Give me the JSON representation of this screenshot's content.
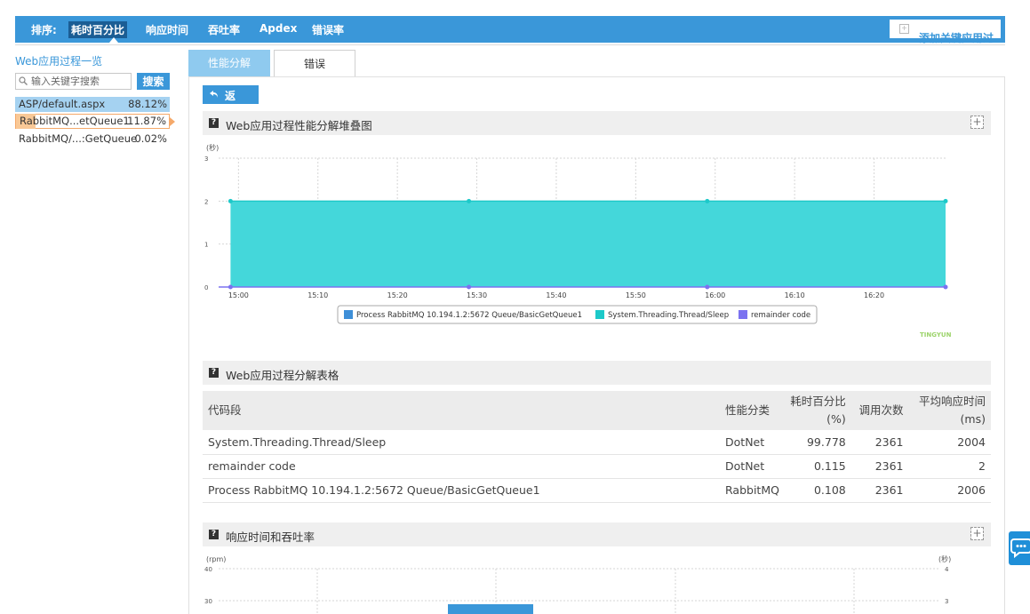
{
  "topbar": {
    "sort_label": "排序:",
    "sort_items": [
      "耗时百分比",
      "响应时间",
      "吞吐率",
      "Apdex",
      "错误率"
    ],
    "add_button": "添加关键应用过"
  },
  "sidebar": {
    "title": "Web应用过程一览",
    "search_placeholder": "输入关键字搜索",
    "search_button": "搜索",
    "items": [
      {
        "name": "ASP/default.aspx",
        "percent": "88.12%",
        "value": 88.12
      },
      {
        "name": "RabbitMQ...etQueue1",
        "percent": "11.87%",
        "value": 11.87
      },
      {
        "name": "RabbitMQ/...:GetQueue",
        "percent": "0.02%",
        "value": 0.02
      }
    ]
  },
  "tabs": [
    "性能分解",
    "错误"
  ],
  "back_button": "返",
  "section1": {
    "title": "Web应用过程性能分解堆叠图"
  },
  "section2": {
    "title": "Web应用过程分解表格"
  },
  "section3": {
    "title": "响应时间和吞吐率"
  },
  "colors": {
    "primary": "#3a97d9",
    "area": "#40d6d9",
    "process": "#3e8fd8",
    "thread": "#1cc9c9",
    "remainder": "#7b72f0"
  },
  "chart_data": [
    {
      "type": "area",
      "ylabel": "(秒)",
      "ylim": [
        0,
        3
      ],
      "yticks": [
        "0",
        "1",
        "2",
        "3"
      ],
      "xticks": [
        "15:00",
        "15:10",
        "15:20",
        "15:30",
        "15:40",
        "15:50",
        "16:00",
        "16:10",
        "16:20"
      ],
      "x": [
        "14:59",
        "15:29",
        "15:59",
        "16:29"
      ],
      "series": [
        {
          "name": "Process RabbitMQ 10.194.1.2:5672 Queue/BasicGetQueue1",
          "values": [
            0,
            0,
            0,
            0
          ]
        },
        {
          "name": "System.Threading.Thread/Sleep",
          "values": [
            2,
            2,
            2,
            2
          ]
        },
        {
          "name": "remainder code",
          "values": [
            0,
            0,
            0,
            0
          ]
        }
      ],
      "legend": "bottom",
      "watermark": "TINGYUN",
      "grid": true
    },
    {
      "type": "bar",
      "ylabel_left": "(rpm)",
      "ylabel_right": "(秒)",
      "yticks_left": [
        "40",
        "30"
      ],
      "yticks_right": [
        "4",
        "3"
      ]
    }
  ],
  "table": {
    "headers": [
      "代码段",
      "性能分类",
      "耗时百分比 (%)",
      "调用次数",
      "平均响应时间 (ms)"
    ],
    "rows": [
      [
        "System.Threading.Thread/Sleep",
        "DotNet",
        "99.778",
        "2361",
        "2004"
      ],
      [
        "remainder code",
        "DotNet",
        "0.115",
        "2361",
        "2"
      ],
      [
        "Process RabbitMQ 10.194.1.2:5672 Queue/BasicGetQueue1",
        "RabbitMQ",
        "0.108",
        "2361",
        "2006"
      ]
    ]
  }
}
